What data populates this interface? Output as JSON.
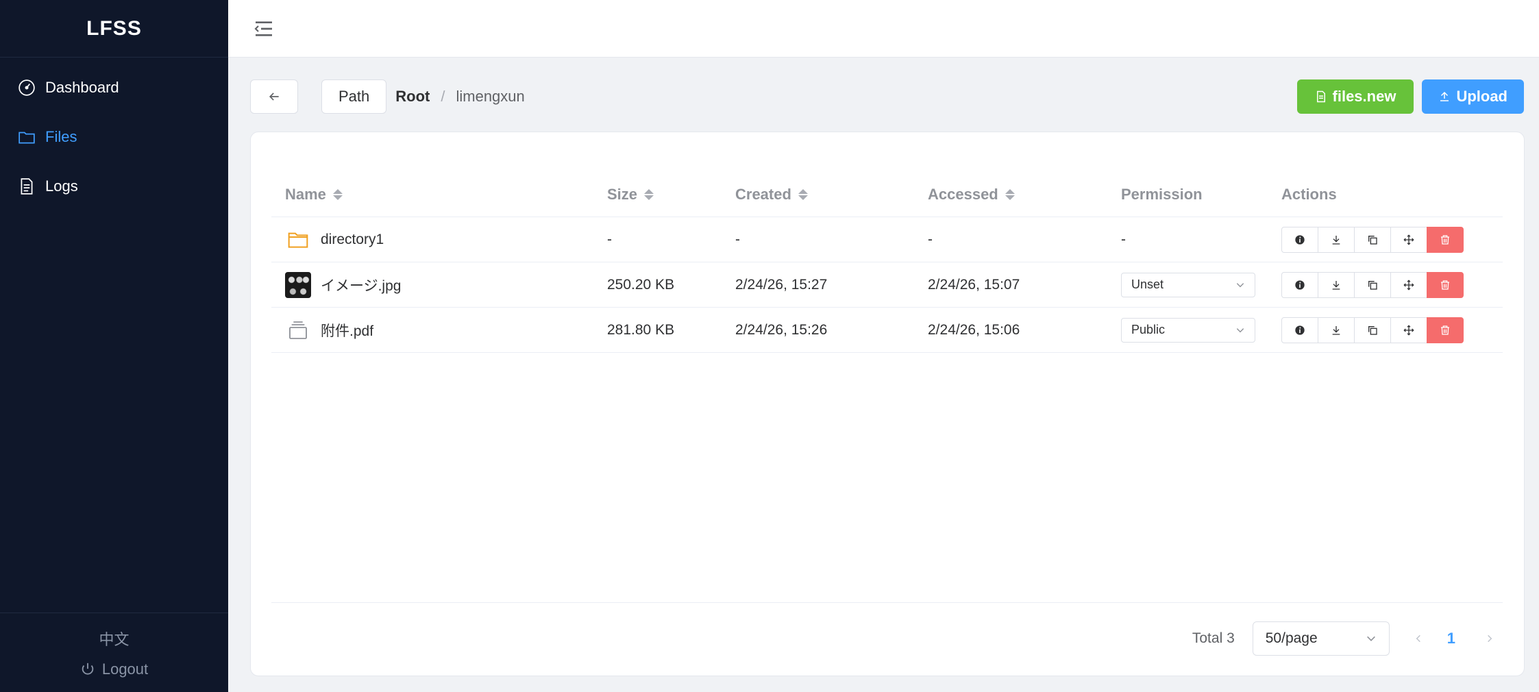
{
  "app": {
    "brand": "LFSS"
  },
  "sidebar": {
    "items": [
      {
        "label": "Dashboard",
        "icon": "dashboard-icon"
      },
      {
        "label": "Files",
        "icon": "folder-icon",
        "active": true
      },
      {
        "label": "Logs",
        "icon": "document-icon"
      }
    ],
    "language": "中文",
    "logout": "Logout"
  },
  "toolbar": {
    "path_label": "Path",
    "crumb_root": "Root",
    "crumb_sep": "/",
    "crumb_user": "limengxun",
    "new_label": "files.new",
    "upload_label": "Upload"
  },
  "table": {
    "headers": {
      "name": "Name",
      "size": "Size",
      "created": "Created",
      "accessed": "Accessed",
      "permission": "Permission",
      "actions": "Actions"
    },
    "rows": [
      {
        "name": "directory1",
        "size": "-",
        "created": "-",
        "accessed": "-",
        "permission": "-"
      },
      {
        "name": "イメージ.jpg",
        "size": "250.20 KB",
        "created": "2/24/26, 15:27",
        "accessed": "2/24/26, 15:07",
        "permission": "Unset"
      },
      {
        "name": "附件.pdf",
        "size": "281.80 KB",
        "created": "2/24/26, 15:26",
        "accessed": "2/24/26, 15:06",
        "permission": "Public"
      }
    ]
  },
  "pagination": {
    "total": "Total 3",
    "page_size": "50/page",
    "current_page": "1"
  },
  "colors": {
    "sidebar_bg": "#0f172a",
    "accent": "#409eff",
    "success": "#67c23a",
    "danger": "#f56c6c"
  }
}
